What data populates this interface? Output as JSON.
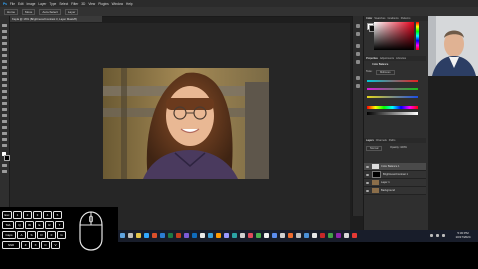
{
  "app": {
    "menu": [
      "Ps",
      "File",
      "Edit",
      "Image",
      "Layer",
      "Type",
      "Select",
      "Filter",
      "3D",
      "View",
      "Plugins",
      "Window",
      "Help"
    ],
    "options_bar": [
      "Home",
      "Move",
      "Auto-Select",
      "Layer"
    ],
    "document_tab": "Kayla @ 16% (Brightness/Contrast 3, Layer Mask/8)"
  },
  "panels": {
    "color_tabs": [
      "Color",
      "Swatches",
      "Gradients",
      "Patterns"
    ],
    "properties_tabs": [
      "Properties",
      "Adjustments",
      "Libraries"
    ],
    "adjustment_title": "Color Balance",
    "tone_label": "Tone:",
    "tone_value": "Midtones",
    "layers_tabs": [
      "Layers",
      "Channels",
      "Paths"
    ],
    "blend_mode": "Normal",
    "opacity_label": "Opacity: 100%",
    "layers": [
      {
        "name": "Color Balance 1"
      },
      {
        "name": "Brightness/Contrast 1"
      },
      {
        "name": "Layer 1"
      },
      {
        "name": "Background"
      }
    ]
  },
  "status": {
    "zoom": "16%"
  },
  "taskbar": {
    "time": "5:30 PM",
    "date": "10/17/2024"
  },
  "overlay": {
    "key_rows": [
      [
        "Esc",
        "1",
        "2",
        "3",
        "4",
        "5"
      ],
      [
        "Tab",
        "Q",
        "W",
        "E",
        "R",
        "T"
      ],
      [
        "Caps",
        "A",
        "S",
        "D",
        "F",
        "G"
      ],
      [
        "Shift",
        "Z",
        "X",
        "C",
        "V"
      ]
    ]
  },
  "colors": {
    "accent": "#e6001a",
    "taskbar": "#181d2a",
    "canvas_bg": "#262626"
  }
}
